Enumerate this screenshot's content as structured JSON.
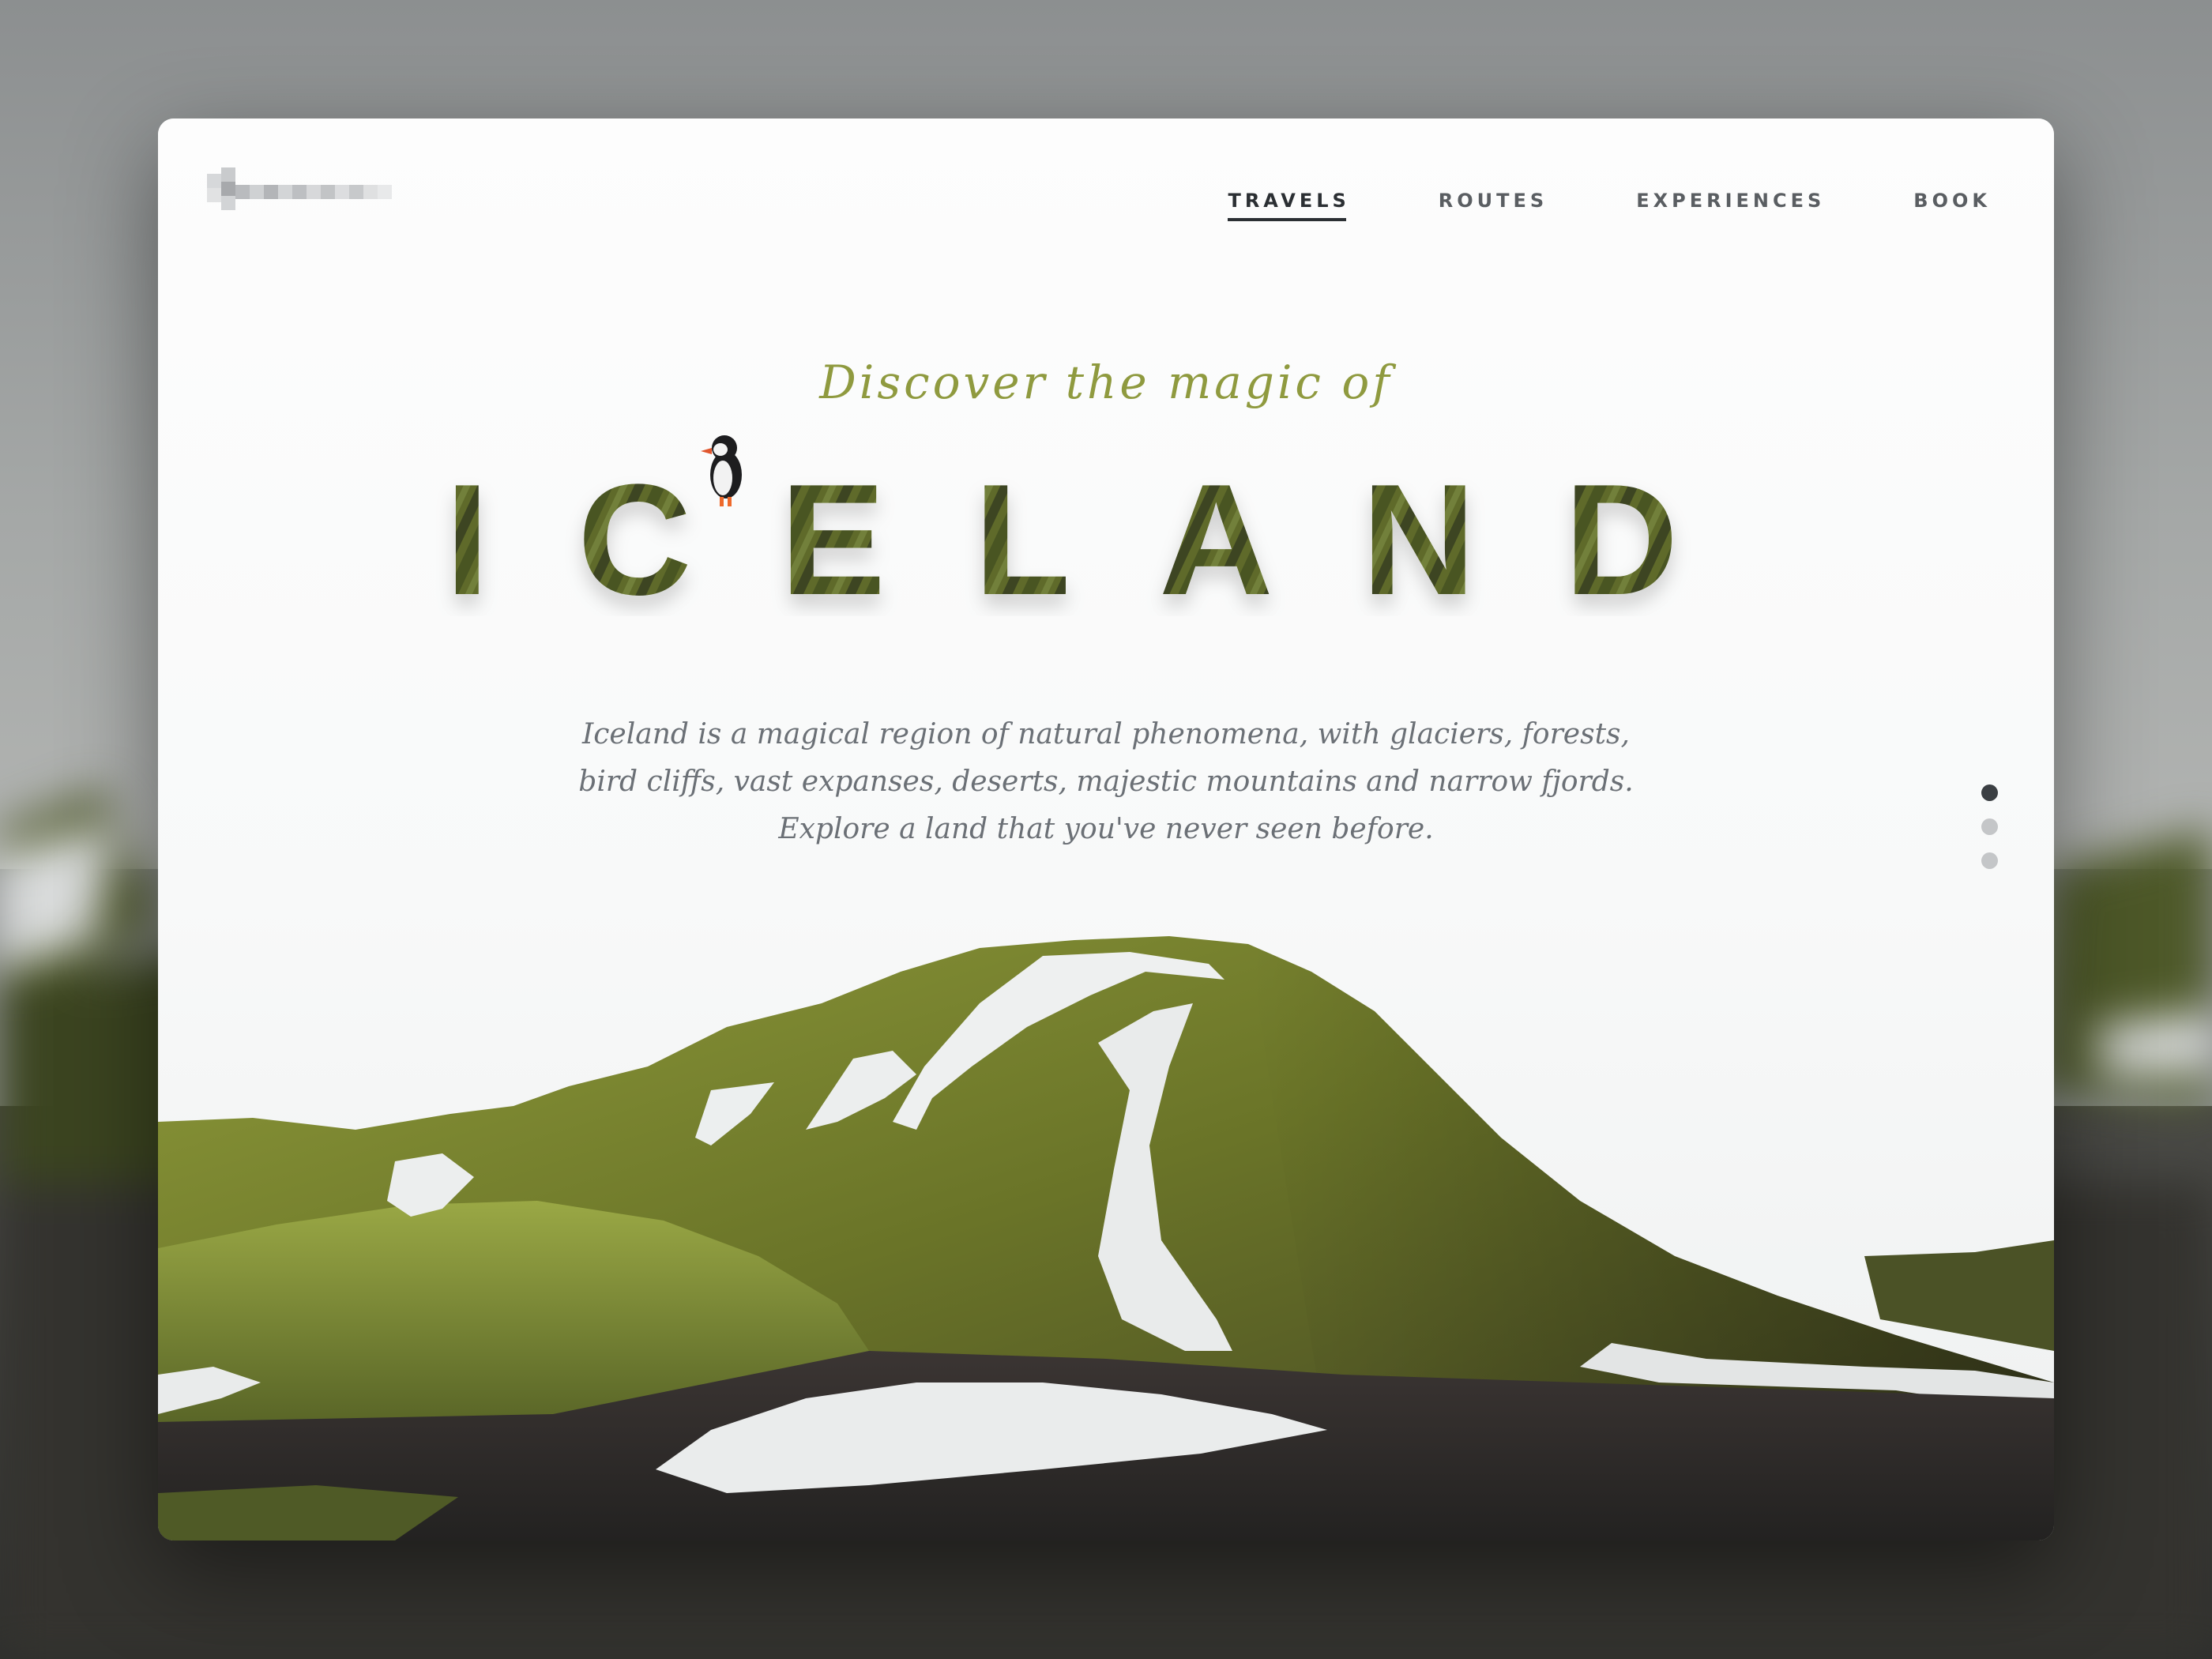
{
  "header": {
    "logo_text": "",
    "nav": [
      {
        "label": "TRAVELS",
        "active": true
      },
      {
        "label": "ROUTES",
        "active": false
      },
      {
        "label": "EXPERIENCES",
        "active": false
      },
      {
        "label": "BOOK",
        "active": false
      }
    ]
  },
  "hero": {
    "kicker": "Discover the magic of",
    "title": "ICELAND",
    "description_lines": [
      "Iceland is  a magical region of natural phenomena, with glaciers, forests,",
      "bird cliffs, vast expanses, deserts, majestic mountains and narrow fjords.",
      "Explore a land that you've never seen before."
    ]
  },
  "slider": {
    "count": 3,
    "active_index": 0
  },
  "colors": {
    "accent": "#8f9a3f",
    "nav_text": "#5a5e62",
    "nav_active": "#2b2f33",
    "body_text": "#6b7076",
    "moss": "#6f7d2c",
    "snow": "#eceeee",
    "gravel": "#2e2b2a"
  }
}
